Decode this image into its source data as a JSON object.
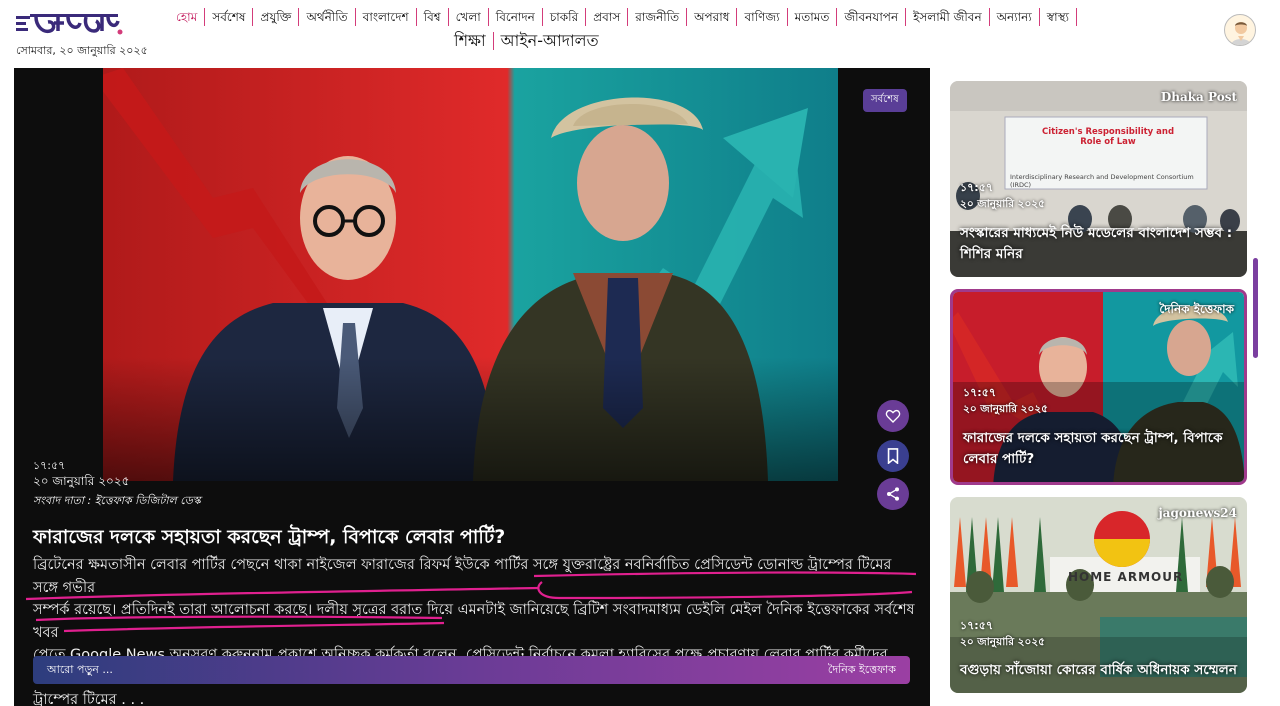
{
  "header": {
    "logo_text": "ইত্তেফাক",
    "date": "সোমবার, ২০ জানুয়ারি ২০২৫",
    "nav_row1": [
      "হোম",
      "সর্বশেষ",
      "প্রযুক্তি",
      "অর্থনীতি",
      "বাংলাদেশ",
      "বিশ্ব",
      "খেলা",
      "বিনোদন",
      "চাকরি",
      "প্রবাস",
      "রাজনীতি",
      "অপরাধ",
      "বাণিজ্য",
      "মতামত",
      "জীবনযাপন",
      "ইসলামী জীবন",
      "অন্যান্য",
      "স্বাস্থ্য"
    ],
    "nav_row2": [
      "শিক্ষা",
      "আইন-আদালত"
    ],
    "active_nav": "হোম"
  },
  "main": {
    "badge": "সর্বশেষ",
    "time": "১৭:৫৭",
    "date": "২০ জানুয়ারি ২০২৫",
    "source_line": "সংবাদ দাতা : ইত্তেফাক ডিজিটাল ডেস্ক",
    "headline": "ফারাজের দলকে সহায়তা করছেন ট্রাম্প, বিপাকে লেবার পার্টি?",
    "summary_lines": [
      "ব্রিটেনের ক্ষমতাসীন লেবার পার্টির পেছনে থাকা নাইজেল ফারাজের রিফর্ম ইউকে পার্টির সঙ্গে যুক্তরাষ্ট্রের নবনির্বাচিত প্রেসিডেন্ট ডোনাল্ড ট্রাম্পের টিমের সঙ্গে গভীর",
      "সম্পর্ক রয়েছে। প্রতিদিনই তারা আলোচনা করছে। দলীয় সূত্রের বরাত দিয়ে এমনটাই জানিয়েছে ব্রিটিশ সংবাদমাধ্যম ডেইলি মেইল দৈনিক ইত্তেফাকের সর্বশেষ খবর",
      "পেতে Google News অনুসরণ করুননাম প্রকাশে অনিচ্ছুক কর্মকর্তা বলেন, প্রেসিডেন্ট নির্বাচনে কমলা হ্যারিসের পক্ষে প্রচারণায় লেবার পার্টির কর্মীদের পাঠানোয়",
      "ট্রাম্পের টিমের . . ."
    ],
    "read_more": "আরো পড়ুন ...",
    "publisher": "দৈনিক ইত্তেফাক",
    "icons": [
      "heart-icon",
      "bookmark-icon",
      "share-icon"
    ]
  },
  "sidebar": [
    {
      "source": "Dhaka Post",
      "banner_title": "Citizen's Responsibility and Role of Law",
      "banner_sub": "Interdisciplinary Research and Development Consortium (IRDC)",
      "time": "১৭:৫৭",
      "date": "২০ জানুয়ারি ২০২৫",
      "title": "সংস্কারের মাধ্যমেই নিউ মডেলের বাংলাদেশ সম্ভব : শিশির মনির"
    },
    {
      "source": "দৈনিক ইত্তেফাক",
      "time": "১৭:৫৭",
      "date": "২০ জানুয়ারি ২০২৫",
      "title": "ফারাজের দলকে সহায়তা করছেন ট্রাম্প, বিপাকে লেবার পার্টি?"
    },
    {
      "source": "jagonews24",
      "banner_text": "HOME ARMOUR",
      "time": "১৭:৫৭",
      "date": "২০ জানুয়ারি ২০২৫",
      "title": "বগুড়ায় সাঁজোয়া কোরের বার্ষিক অধিনায়ক সম্মেলন"
    }
  ],
  "colors": {
    "accent": "#c2185b",
    "badge": "#5a3e97",
    "underline": "#e0208f",
    "bar_start": "#2d3d7d",
    "bar_end": "#9b3fa3"
  }
}
